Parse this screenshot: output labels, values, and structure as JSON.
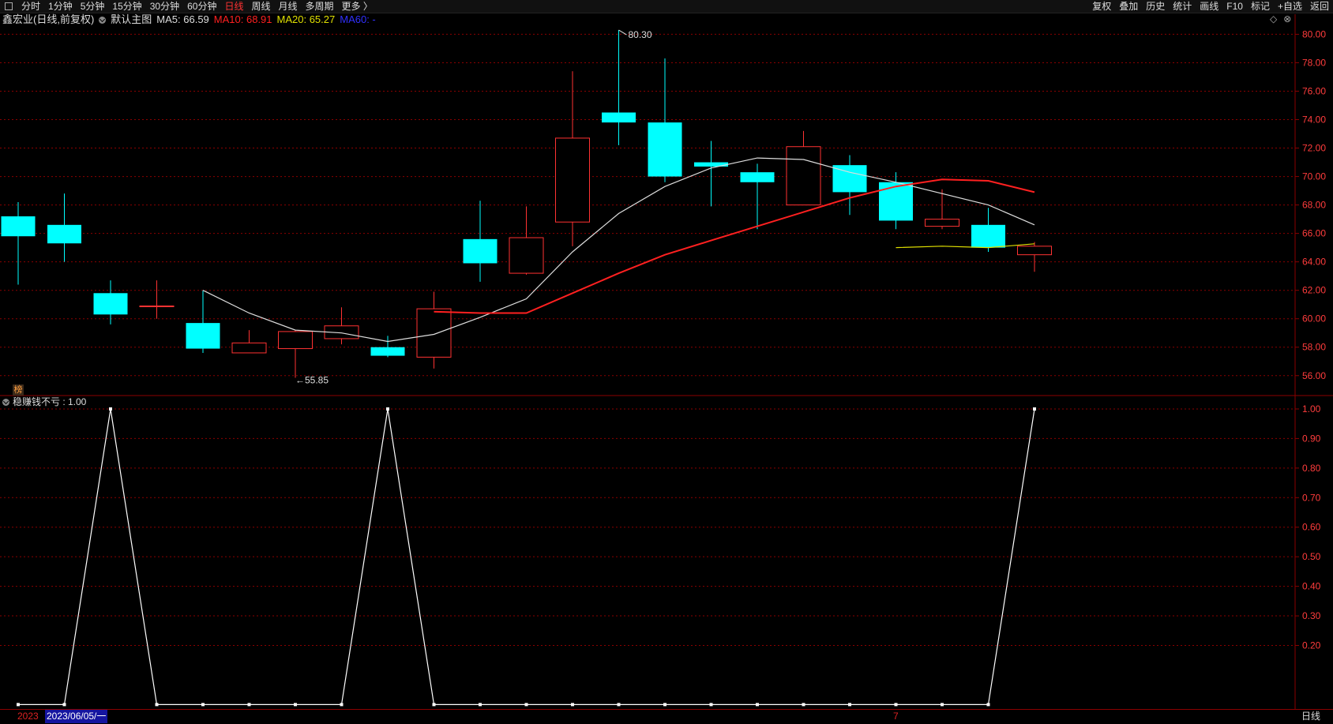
{
  "topbar": {
    "tabs": [
      "分时",
      "1分钟",
      "5分钟",
      "15分钟",
      "30分钟",
      "60分钟",
      "日线",
      "周线",
      "月线",
      "多周期",
      "更多 〉"
    ],
    "active_tab": "日线",
    "right_buttons": [
      "复权",
      "叠加",
      "历史",
      "统计",
      "画线",
      "F10",
      "标记",
      "+自选",
      "返回"
    ]
  },
  "chart_header": {
    "stock": "鑫宏业(日线,前复权)",
    "template": "默认主图",
    "ma5_label": "MA5: 66.59",
    "ma10_label": "MA10: 68.91",
    "ma20_label": "MA20: 65.27",
    "ma60_label": "MA60: -",
    "controls": [
      "◇",
      "⊗"
    ]
  },
  "indicator_header": {
    "name_value": "稳赚钱不亏 : 1.00"
  },
  "badge": "榜",
  "annotations": {
    "high_label": "80.30",
    "low_label": "←55.85"
  },
  "bottom": {
    "year": "2023",
    "selected_date": "2023/06/05/一",
    "month_mark": "7",
    "period": "日线"
  },
  "colors": {
    "up": "#ff3232",
    "down": "#00ffff",
    "ma5": "#dddddd",
    "ma10": "#ff2020",
    "ma20": "#e0e000",
    "ma60": "#3030ff",
    "grid": "#8b0000",
    "axis_text": "#ff3c3c"
  },
  "chart_data": [
    {
      "type": "candlestick",
      "title": "鑫宏业(日线,前复权)",
      "y_ticks": [
        "80.00",
        "78.00",
        "76.00",
        "74.00",
        "72.00",
        "70.00",
        "68.00",
        "66.00",
        "64.00",
        "62.00",
        "60.00",
        "58.00",
        "56.00"
      ],
      "ylim": [
        54.6,
        81.3
      ],
      "candles": [
        {
          "o": 67.2,
          "h": 68.2,
          "l": 62.4,
          "c": 65.8
        },
        {
          "o": 66.6,
          "h": 68.8,
          "l": 64.0,
          "c": 65.3
        },
        {
          "o": 61.8,
          "h": 62.7,
          "l": 59.6,
          "c": 60.3
        },
        {
          "o": 60.9,
          "h": 62.7,
          "l": 60.0,
          "c": 60.9
        },
        {
          "o": 59.7,
          "h": 62.0,
          "l": 57.6,
          "c": 57.9
        },
        {
          "o": 57.6,
          "h": 59.2,
          "l": 57.6,
          "c": 58.3
        },
        {
          "o": 57.9,
          "h": 59.2,
          "l": 55.85,
          "c": 59.1
        },
        {
          "o": 58.6,
          "h": 60.8,
          "l": 58.2,
          "c": 59.5
        },
        {
          "o": 58.0,
          "h": 58.8,
          "l": 57.3,
          "c": 57.4
        },
        {
          "o": 57.3,
          "h": 61.9,
          "l": 56.5,
          "c": 60.7
        },
        {
          "o": 65.6,
          "h": 68.3,
          "l": 62.6,
          "c": 63.9
        },
        {
          "o": 63.2,
          "h": 67.9,
          "l": 63.1,
          "c": 65.7
        },
        {
          "o": 66.8,
          "h": 77.4,
          "l": 65.1,
          "c": 72.7
        },
        {
          "o": 74.5,
          "h": 80.3,
          "l": 72.2,
          "c": 73.8
        },
        {
          "o": 73.8,
          "h": 78.3,
          "l": 69.6,
          "c": 70.0
        },
        {
          "o": 71.0,
          "h": 72.5,
          "l": 67.9,
          "c": 70.7
        },
        {
          "o": 70.3,
          "h": 70.9,
          "l": 66.3,
          "c": 69.6
        },
        {
          "o": 68.0,
          "h": 73.2,
          "l": 68.0,
          "c": 72.1
        },
        {
          "o": 70.8,
          "h": 71.5,
          "l": 67.3,
          "c": 68.9
        },
        {
          "o": 69.6,
          "h": 70.3,
          "l": 66.3,
          "c": 66.9
        },
        {
          "o": 66.5,
          "h": 69.1,
          "l": 66.3,
          "c": 67.0
        },
        {
          "o": 66.6,
          "h": 67.8,
          "l": 64.7,
          "c": 65.0
        },
        {
          "o": 64.5,
          "h": 65.4,
          "l": 63.3,
          "c": 65.1
        }
      ],
      "ma5": [
        null,
        null,
        null,
        null,
        62.0,
        60.4,
        59.2,
        59.0,
        58.4,
        58.9,
        60.1,
        61.4,
        64.7,
        67.4,
        69.3,
        70.6,
        71.3,
        71.2,
        70.3,
        69.6,
        68.8,
        68.0,
        66.6
      ],
      "ma10": [
        null,
        null,
        null,
        null,
        null,
        null,
        null,
        null,
        null,
        60.5,
        60.4,
        60.4,
        61.8,
        63.2,
        64.5,
        65.5,
        66.5,
        67.5,
        68.5,
        69.3,
        69.8,
        69.7,
        68.9
      ],
      "ma20": [
        null,
        null,
        null,
        null,
        null,
        null,
        null,
        null,
        null,
        null,
        null,
        null,
        null,
        null,
        null,
        null,
        null,
        null,
        null,
        65.0,
        65.1,
        65.0,
        65.27
      ],
      "high_value": 80.3,
      "low_value": 55.85
    },
    {
      "type": "line",
      "title": "稳赚钱不亏",
      "y_ticks": [
        "1.00",
        "0.90",
        "0.80",
        "0.70",
        "0.60",
        "0.50",
        "0.40",
        "0.30",
        "0.20"
      ],
      "ylim": [
        -0.015,
        1.04
      ],
      "values": [
        0,
        0,
        1,
        0,
        0,
        0,
        0,
        0,
        1,
        0,
        0,
        0,
        0,
        0,
        0,
        0,
        0,
        0,
        0,
        0,
        0,
        0,
        1
      ]
    }
  ]
}
